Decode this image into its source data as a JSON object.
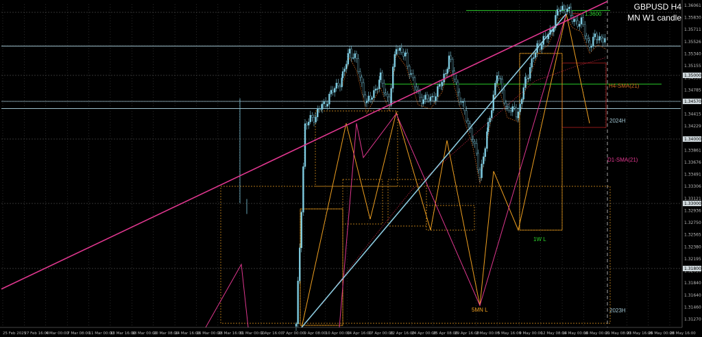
{
  "header": {
    "symbol": "GBPUSD H4",
    "subtitle": "MN W1 candle"
  },
  "colors": {
    "background": "#000000",
    "candle": "#7ecbe0",
    "trendline": "#e0378f",
    "zigzag": "#f0a020",
    "lightblue": "#8ccbe0",
    "green": "#2bd12b",
    "red": "#cc2222",
    "sma_h4": "#d2691e",
    "sma_d1": "#b0213a",
    "level": "#9fc3d0",
    "grid": "#555555"
  },
  "chart_data": {
    "type": "candlestick",
    "symbol": "GBPUSD",
    "timeframe": "H4",
    "ylim": [
      1.212,
      1.363
    ],
    "y_ticks": [
      "1.36061",
      "1.35830",
      "1.35711",
      "1.35526",
      "1.35340",
      "1.35155",
      "1.34950",
      "1.34785",
      "1.34570",
      "1.34415",
      "1.34229",
      "1.34000",
      "1.33861",
      "1.33676",
      "1.33491",
      "1.33306",
      "1.33121",
      "1.32936",
      "1.32750",
      "1.32565",
      "1.32380",
      "1.32195",
      "1.32010",
      "1.31840",
      "1.31640",
      "1.31460",
      "1.31270"
    ],
    "highlighted_prices": [
      "1.35000",
      "1.34570",
      "1.34000",
      "1.33000",
      "1.31800"
    ],
    "x_ticks": [
      "25 Feb 2025",
      "27 Feb 16:00",
      "4 Mar 00:00",
      "7 Mar 08:00",
      "11 Mar 00:00",
      "13 Mar 16:00",
      "18 Mar 00:00",
      "20 Mar 08:00",
      "24 Mar 16:00",
      "26 Mar 00:00",
      "28 Mar 16:00",
      "31 Mar 00:00",
      "2 Apr 16:00",
      "7 Apr 00:00",
      "9 Apr 08:00",
      "10 Apr 00:00",
      "14 Apr 16:00",
      "17 Apr 00:00",
      "22 Apr 16:00",
      "24 Apr 00:00",
      "25 Apr 08:00",
      "29 Apr 16:00",
      "2 May 00:00",
      "5 May 16:00",
      "9 May 00:00",
      "12 May 08:00",
      "14 May 00:00",
      "16 May 00:00",
      "21 May 08:00",
      "23 May 16:00",
      "26 May 00:00",
      "28 May 16:00"
    ],
    "annotations": {
      "level_1_36": "1.3600",
      "h4_sma": "H4-SMA(21)",
      "h2024": "2024H",
      "d1_sma": "D1-SMA(21)",
      "w1_low": "1W L",
      "mn_low": "5MN L",
      "h2023": "2023H"
    },
    "levels": {
      "h2024": 1.3434,
      "h2023": 1.3142,
      "w1_low": 1.3256,
      "level_36": 1.36
    },
    "close_series": [
      1.3365,
      1.338,
      1.341,
      1.345,
      1.35,
      1.353,
      1.356,
      1.359,
      1.36,
      1.361,
      1.359,
      1.355,
      1.352,
      1.348,
      1.346,
      1.348,
      1.351,
      1.349,
      1.346,
      1.343,
      1.348,
      1.349,
      1.347,
      1.344,
      1.323,
      1.326,
      1.328,
      1.33,
      1.332,
      1.334,
      1.336,
      1.338,
      1.34,
      1.341,
      1.342,
      1.339,
      1.335,
      1.332,
      1.33,
      1.333,
      1.327,
      1.329,
      1.331,
      1.333,
      1.33,
      1.328,
      1.33,
      1.331,
      1.328,
      1.326,
      1.324,
      1.32,
      1.317,
      1.315,
      1.32,
      1.323,
      1.324,
      1.327,
      1.329,
      1.331,
      1.332,
      1.335,
      1.338,
      1.34
    ]
  }
}
